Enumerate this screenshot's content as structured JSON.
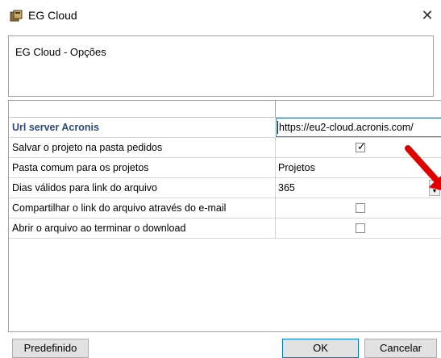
{
  "window": {
    "title": "EG Cloud",
    "close_icon": "✕"
  },
  "header": {
    "text": "EG Cloud - Opções"
  },
  "grid": {
    "rows": [
      {
        "label": "Url server Acronis",
        "value": "https://eu2-cloud.acronis.com/",
        "type": "text",
        "bold": true
      },
      {
        "label": "Salvar o projeto na pasta pedidos",
        "type": "checkbox",
        "checked": true
      },
      {
        "label": "Pasta comum para os projetos",
        "value": "Projetos",
        "type": "text"
      },
      {
        "label": "Dias válidos para link do arquivo",
        "value": "365",
        "type": "spinner"
      },
      {
        "label": "Compartilhar o link do arquivo através do e-mail",
        "type": "checkbox",
        "checked": false
      },
      {
        "label": "Abrir o arquivo ao terminar o download",
        "type": "checkbox",
        "checked": false
      }
    ]
  },
  "buttons": {
    "default_label": "Predefinido",
    "ok_label": "OK",
    "cancel_label": "Cancelar"
  },
  "colors": {
    "accent_border": "#0078d7",
    "bold_label": "#2e4a7a",
    "annotation_arrow": "#e00000"
  }
}
